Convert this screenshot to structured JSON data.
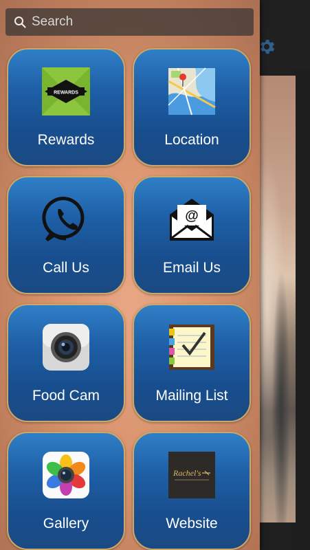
{
  "search": {
    "placeholder": "Search"
  },
  "background": {
    "settings_icon": "gear-icon"
  },
  "colors": {
    "tile_blue": "#1e5fa6",
    "tile_border": "#c9a86a",
    "drawer_tint": "#d9916c"
  },
  "tiles": [
    {
      "label": "Rewards",
      "icon": "rewards-icon"
    },
    {
      "label": "Location",
      "icon": "map-icon"
    },
    {
      "label": "Call Us",
      "icon": "phone-icon"
    },
    {
      "label": "Email Us",
      "icon": "envelope-icon"
    },
    {
      "label": "Food Cam",
      "icon": "camera-icon"
    },
    {
      "label": "Mailing List",
      "icon": "notepad-icon"
    },
    {
      "label": "Gallery",
      "icon": "photos-icon"
    },
    {
      "label": "Website",
      "icon": "website-logo-icon"
    }
  ],
  "website_logo": {
    "text": "Rachel's"
  }
}
